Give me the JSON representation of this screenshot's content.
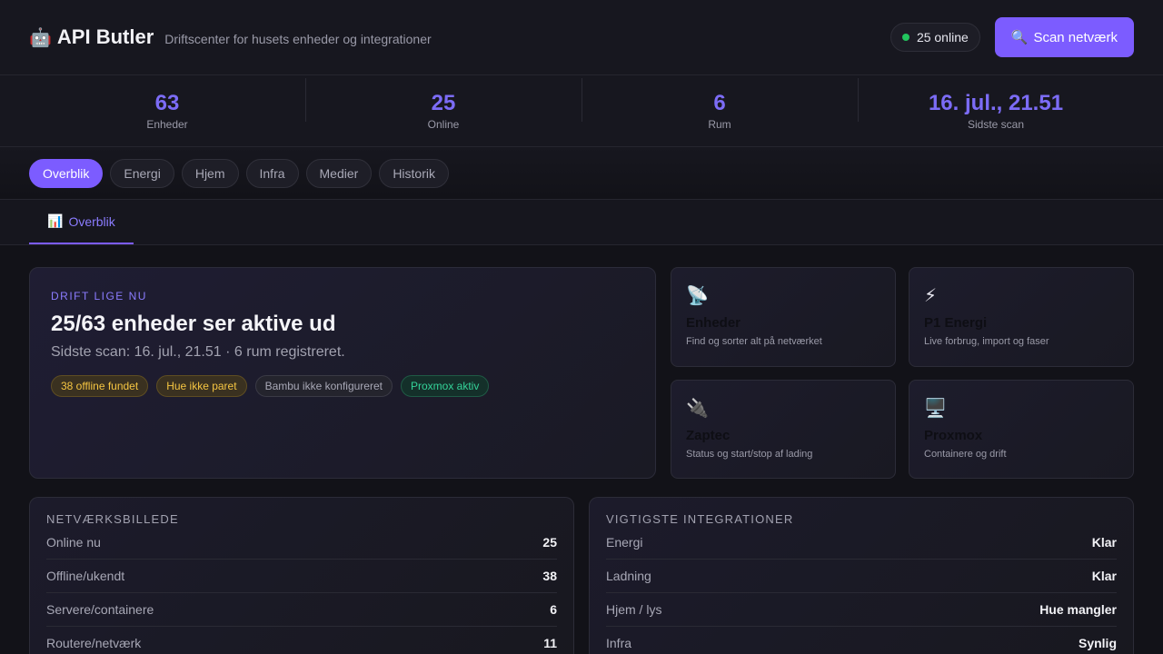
{
  "header": {
    "title": "API Butler",
    "subtitle": "Driftscenter for husets enheder og integrationer",
    "online_label": "25 online",
    "scan_label": "Scan netværk"
  },
  "stats": [
    {
      "value": "63",
      "label": "Enheder"
    },
    {
      "value": "25",
      "label": "Online"
    },
    {
      "value": "6",
      "label": "Rum"
    },
    {
      "value": "16. jul., 21.51",
      "label": "Sidste scan"
    }
  ],
  "tabs": [
    {
      "label": "Overblik",
      "active": true
    },
    {
      "label": "Energi"
    },
    {
      "label": "Hjem"
    },
    {
      "label": "Infra"
    },
    {
      "label": "Medier"
    },
    {
      "label": "Historik"
    }
  ],
  "subtab": {
    "label": "Overblik"
  },
  "hero": {
    "eyebrow": "DRIFT LIGE NU",
    "title": "25/63 enheder ser aktive ud",
    "subtitle": "Sidste scan: 16. jul., 21.51 · 6 rum registreret.",
    "badges": [
      {
        "label": "38 offline fundet",
        "tone": "warn"
      },
      {
        "label": "Hue ikke paret",
        "tone": "warn"
      },
      {
        "label": "Bambu ikke konfigureret",
        "tone": "neutral"
      },
      {
        "label": "Proxmox aktiv",
        "tone": "ok"
      }
    ]
  },
  "cards": [
    {
      "icon": "satellite-dish-icon",
      "title": "Enheder",
      "subtitle": "Find og sorter alt på netværket"
    },
    {
      "icon": "lightning-icon",
      "title": "P1 Energi",
      "subtitle": "Live forbrug, import og faser"
    },
    {
      "icon": "plug-icon",
      "title": "Zaptec",
      "subtitle": "Status og start/stop af lading"
    },
    {
      "icon": "monitor-icon",
      "title": "Proxmox",
      "subtitle": "Containere og drift"
    }
  ],
  "network": {
    "title": "NETVÆRKSBILLEDE",
    "rows": [
      {
        "k": "Online nu",
        "v": "25"
      },
      {
        "k": "Offline/ukendt",
        "v": "38"
      },
      {
        "k": "Servere/containere",
        "v": "6"
      },
      {
        "k": "Routere/netværk",
        "v": "11"
      }
    ]
  },
  "integrations": {
    "title": "VIGTIGSTE INTEGRATIONER",
    "rows": [
      {
        "k": "Energi",
        "v": "Klar"
      },
      {
        "k": "Ladning",
        "v": "Klar"
      },
      {
        "k": "Hjem / lys",
        "v": "Hue mangler"
      },
      {
        "k": "Infra",
        "v": "Synlig"
      }
    ]
  }
}
